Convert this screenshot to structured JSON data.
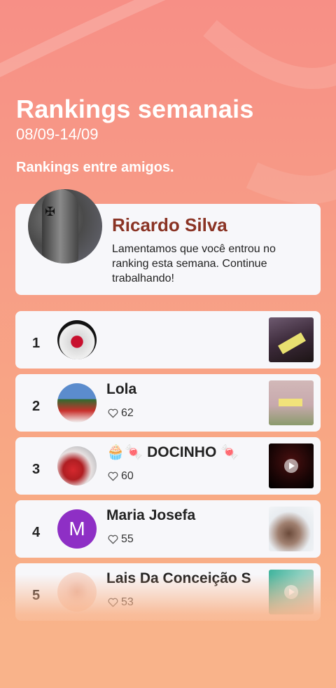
{
  "header": {
    "title": "Rankings semanais",
    "date_range": "08/09-14/09",
    "subtitle": "Rankings entre amigos."
  },
  "me": {
    "name": "Ricardo Silva",
    "message": "Lamentamos que você entrou no ranking esta semana. Continue trabalhando!"
  },
  "rankings": [
    {
      "rank": "1",
      "name": "",
      "likes": ""
    },
    {
      "rank": "2",
      "name": "Lola",
      "likes": "62"
    },
    {
      "rank": "3",
      "name": "🧁🍬 DOCINHO 🍬",
      "likes": "60"
    },
    {
      "rank": "4",
      "name": "Maria Josefa",
      "likes": "55",
      "avatar_letter": "M"
    },
    {
      "rank": "5",
      "name": "Lais Da Conceição S",
      "likes": "53"
    }
  ],
  "colors": {
    "me_name": "#8a3324",
    "avatar_purple": "#8e2fc5"
  },
  "icons": {
    "likes": "heart-outline-icon",
    "video": "play-icon"
  }
}
